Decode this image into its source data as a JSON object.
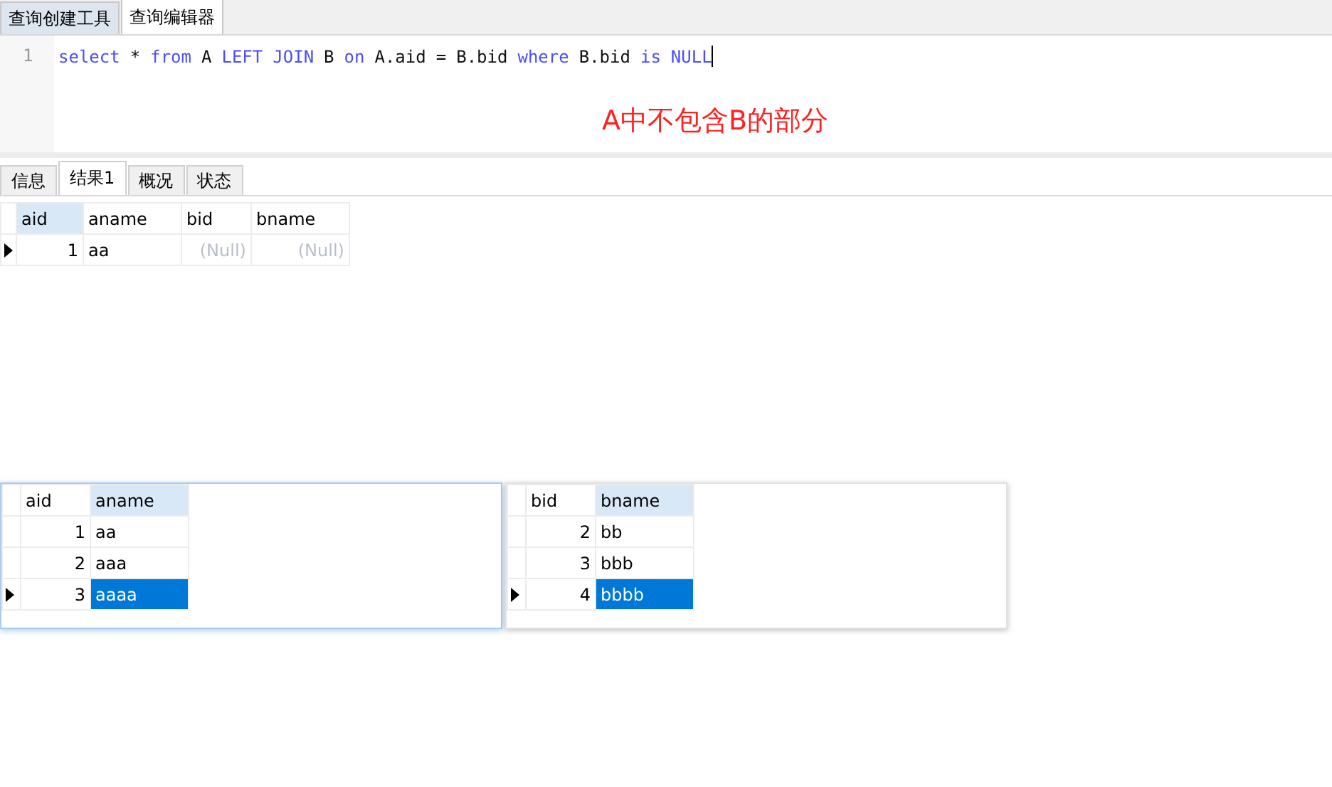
{
  "editor_tabs": [
    {
      "label": "查询创建工具",
      "selected": false
    },
    {
      "label": "查询编辑器",
      "selected": true
    }
  ],
  "editor": {
    "line_number": "1",
    "tokens": [
      {
        "text": "select",
        "kind": "keyword"
      },
      {
        "text": "*",
        "kind": "plain"
      },
      {
        "text": "from",
        "kind": "keyword"
      },
      {
        "text": "A",
        "kind": "plain"
      },
      {
        "text": "LEFT",
        "kind": "keyword"
      },
      {
        "text": "JOIN",
        "kind": "keyword"
      },
      {
        "text": "B",
        "kind": "plain"
      },
      {
        "text": "on",
        "kind": "keyword"
      },
      {
        "text": "A.aid",
        "kind": "plain"
      },
      {
        "text": "=",
        "kind": "plain"
      },
      {
        "text": "B.bid",
        "kind": "plain"
      },
      {
        "text": "where",
        "kind": "keyword"
      },
      {
        "text": "B.bid",
        "kind": "plain"
      },
      {
        "text": "is",
        "kind": "keyword"
      },
      {
        "text": "NULL",
        "kind": "keyword"
      }
    ],
    "annotation": "A中不包含B的部分"
  },
  "result_tabs": [
    {
      "label": "信息",
      "selected": false
    },
    {
      "label": "结果1",
      "selected": true
    },
    {
      "label": "概况",
      "selected": false
    },
    {
      "label": "状态",
      "selected": false
    }
  ],
  "result_grid": {
    "columns": [
      {
        "name": "aid",
        "selected": true
      },
      {
        "name": "aname",
        "selected": false
      },
      {
        "name": "bid",
        "selected": false
      },
      {
        "name": "bname",
        "selected": false
      }
    ],
    "rows": [
      {
        "current": true,
        "cells": [
          {
            "text": "1",
            "kind": "number",
            "selected": false
          },
          {
            "text": "aa",
            "kind": "text",
            "selected": false
          },
          {
            "text": "(Null)",
            "kind": "null",
            "selected": false
          },
          {
            "text": "(Null)",
            "kind": "null",
            "selected": false
          }
        ]
      }
    ]
  },
  "tables": [
    {
      "focused": true,
      "columns": [
        {
          "name": "aid",
          "selected": false
        },
        {
          "name": "aname",
          "selected": true
        }
      ],
      "rows": [
        {
          "current": false,
          "cells": [
            {
              "text": "1",
              "kind": "number",
              "selected": false
            },
            {
              "text": "aa",
              "kind": "text",
              "selected": false
            }
          ]
        },
        {
          "current": false,
          "cells": [
            {
              "text": "2",
              "kind": "number",
              "selected": false
            },
            {
              "text": "aaa",
              "kind": "text",
              "selected": false
            }
          ]
        },
        {
          "current": true,
          "cells": [
            {
              "text": "3",
              "kind": "number",
              "selected": false
            },
            {
              "text": "aaaa",
              "kind": "text",
              "selected": true
            }
          ]
        }
      ]
    },
    {
      "focused": false,
      "columns": [
        {
          "name": "bid",
          "selected": false
        },
        {
          "name": "bname",
          "selected": true
        }
      ],
      "rows": [
        {
          "current": false,
          "cells": [
            {
              "text": "2",
              "kind": "number",
              "selected": false
            },
            {
              "text": "bb",
              "kind": "text",
              "selected": false
            }
          ]
        },
        {
          "current": false,
          "cells": [
            {
              "text": "3",
              "kind": "number",
              "selected": false
            },
            {
              "text": "bbb",
              "kind": "text",
              "selected": false
            }
          ]
        },
        {
          "current": true,
          "cells": [
            {
              "text": "4",
              "kind": "number",
              "selected": false
            },
            {
              "text": "bbbb",
              "kind": "text",
              "selected": true
            }
          ]
        }
      ]
    }
  ]
}
